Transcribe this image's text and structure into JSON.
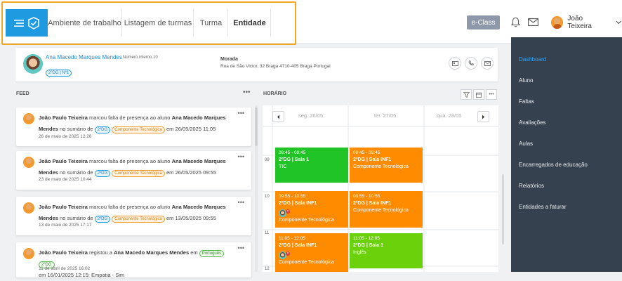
{
  "nav": {
    "tabs": [
      {
        "label": "Ambiente de trabalho"
      },
      {
        "label": "Listagem de turmas"
      },
      {
        "label": "Turma"
      },
      {
        "label": "Entidade"
      }
    ]
  },
  "header": {
    "eclass_label": "e-Class",
    "user_name": "João Teixeira"
  },
  "sidebar": {
    "items": [
      {
        "label": "Dashboard"
      },
      {
        "label": "Aluno"
      },
      {
        "label": "Faltas"
      },
      {
        "label": "Avaliações"
      },
      {
        "label": "Aulas"
      },
      {
        "label": "Encarregados de educação"
      },
      {
        "label": "Relatórios"
      },
      {
        "label": "Entidades a faturar"
      }
    ]
  },
  "student": {
    "name": "Ana Macedo Marques Mendes",
    "internal_number": "Número interno 10",
    "class_badge": "2ºDG | Nº1",
    "address_label": "Morada",
    "address": "Rua de São Victor, 32 Braga 4710-405 Braga Portugal"
  },
  "feed": {
    "title": "FEED",
    "items": [
      {
        "author": "João Paulo Teixeira",
        "action": "marcou falta de presença ao aluno",
        "student": "Ana Macedo Marques Mendes",
        "middle": "no sumário de",
        "badge1": "2ºDG",
        "badge2": "Componente Tecnológica",
        "tail": "em 26/05/2025 11:05",
        "date": "26 de maio de 2025 12:26"
      },
      {
        "author": "João Paulo Teixeira",
        "action": "marcou falta de presença ao aluno",
        "student": "Ana Macedo Marques Mendes",
        "middle": "no sumário de",
        "badge1": "2ºDG",
        "badge2": "Componente Tecnológica",
        "tail": "em 26/05/2025 09:55",
        "date": "23 de maio de 2025 10:44"
      },
      {
        "author": "João Paulo Teixeira",
        "action": "marcou falta de presença ao aluno",
        "student": "Ana Macedo Marques Mendes",
        "middle": "no sumário de",
        "badge1": "2ºDG",
        "badge2": "Componente Tecnológica",
        "tail": "em 13/05/2025 09:55",
        "date": "13 de maio de 2025 17:17"
      },
      {
        "author": "João Paulo Teixeira",
        "action": "registou a",
        "student": "Ana Macedo Marques Mendes",
        "middle": "em",
        "badge1": "Português",
        "badge2": "2ºDG",
        "line2": "em 16/01/2025 12:15: Empatia - Sim",
        "date": "11 de abril de 2025 16:02"
      }
    ]
  },
  "schedule": {
    "title": "HORÁRIO",
    "days": [
      {
        "label": "seg. 26/05"
      },
      {
        "label": "ter. 27/05"
      },
      {
        "label": "qua. 28/05"
      }
    ],
    "hours": [
      "09",
      "10",
      "11",
      "12"
    ],
    "events": [
      {
        "time": "08:45 - 09:45",
        "room": "2ºDG | Sala 1",
        "subject": "TIC"
      },
      {
        "time": "08:45 - 09:45",
        "room": "2ºDG | Sala INF1",
        "subject": "Componente Tecnológica"
      },
      {
        "time": "09:55 - 10:55",
        "room": "2ºDG | Sala INF1",
        "subject": "Componente Tecnológica"
      },
      {
        "time": "09:55 - 10:55",
        "room": "2ºDG | Sala INF1",
        "subject": "Componente Tecnológica"
      },
      {
        "time": "11:05 - 12:05",
        "room": "2ºDG | Sala INF1",
        "subject": "Componente Tecnológica"
      },
      {
        "time": "11:05 - 12:05",
        "room": "2ºDG | Sala 1",
        "subject": "Inglês"
      }
    ],
    "colors": {
      "green": "#21c426",
      "orange": "#fe8b00",
      "lime": "#6ad10a"
    }
  }
}
